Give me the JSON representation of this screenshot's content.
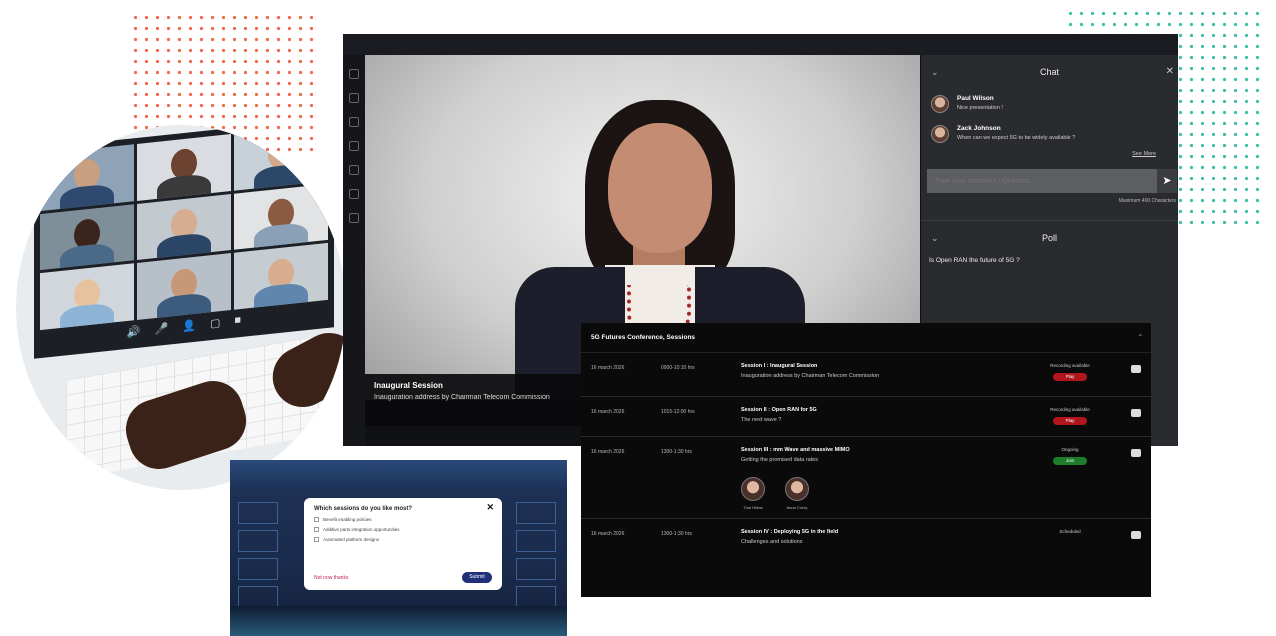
{
  "stage": {
    "session_title": "Inaugural Session",
    "session_subtitle": "Inauguration address by Chairman Telecom Commission"
  },
  "chat": {
    "header": "Chat",
    "messages": [
      {
        "name": "Paul Wilson",
        "text": "Nice presentation !"
      },
      {
        "name": "Zack Johnson",
        "text": "When can we expect 5G to be widely available ?"
      }
    ],
    "see_more": "See More",
    "input_placeholder": "Type your comment / Question",
    "max_chars": "Maximum 400 Characters"
  },
  "poll": {
    "header": "Poll",
    "question": "Is Open RAN the future of 5G ?"
  },
  "sessions": {
    "header": "5G Futures Conference, Sessions",
    "rows": [
      {
        "date": "16 march 2026",
        "time": "0900-10:10 hrs",
        "title": "Session I : Inaugural Session",
        "subtitle": "Inauguration address by Chairman Telecom Commission",
        "status": "Recording available",
        "pill": "Play",
        "pill_color": "red"
      },
      {
        "date": "16 march 2026",
        "time": "1015-12:00 hrs",
        "title": "Session II : Open RAN for 5G",
        "subtitle": "The next wave ?",
        "status": "Recording available",
        "pill": "Play",
        "pill_color": "red"
      },
      {
        "date": "16 march 2026",
        "time": "1300-1:30 hrs",
        "title": "Session III : mm Wave and massive MIMO",
        "subtitle": "Getting the promised data rates",
        "status": "Ongoing",
        "pill": "Join",
        "pill_color": "green"
      },
      {
        "date": "16 march 2026",
        "time": "1300-1:30 hrs",
        "title": "Session IV : Deploying 5G in the field",
        "subtitle": "Challenges and solutions",
        "status": "Scheduled",
        "pill": "",
        "pill_color": ""
      }
    ],
    "speakers": [
      {
        "name": "Thal Hillow"
      },
      {
        "name": "Anna Corey"
      }
    ]
  },
  "survey": {
    "question": "Which sessions do you like most?",
    "options": [
      "Benefit enabling policies",
      "Additive parts integration opportunities",
      "Automated platform designs"
    ],
    "not_now": "Not now thanks",
    "submit": "Submit"
  },
  "video_call": {
    "controls": [
      "speaker-icon",
      "mic-icon",
      "participants-icon",
      "screen-icon",
      "camera-icon"
    ]
  },
  "colors": {
    "dots_orange": "#f26a4b",
    "dots_teal": "#3fc1a9",
    "play_red": "#b0161b",
    "join_green": "#1e7d2a",
    "submit_navy": "#1f2f7a"
  }
}
